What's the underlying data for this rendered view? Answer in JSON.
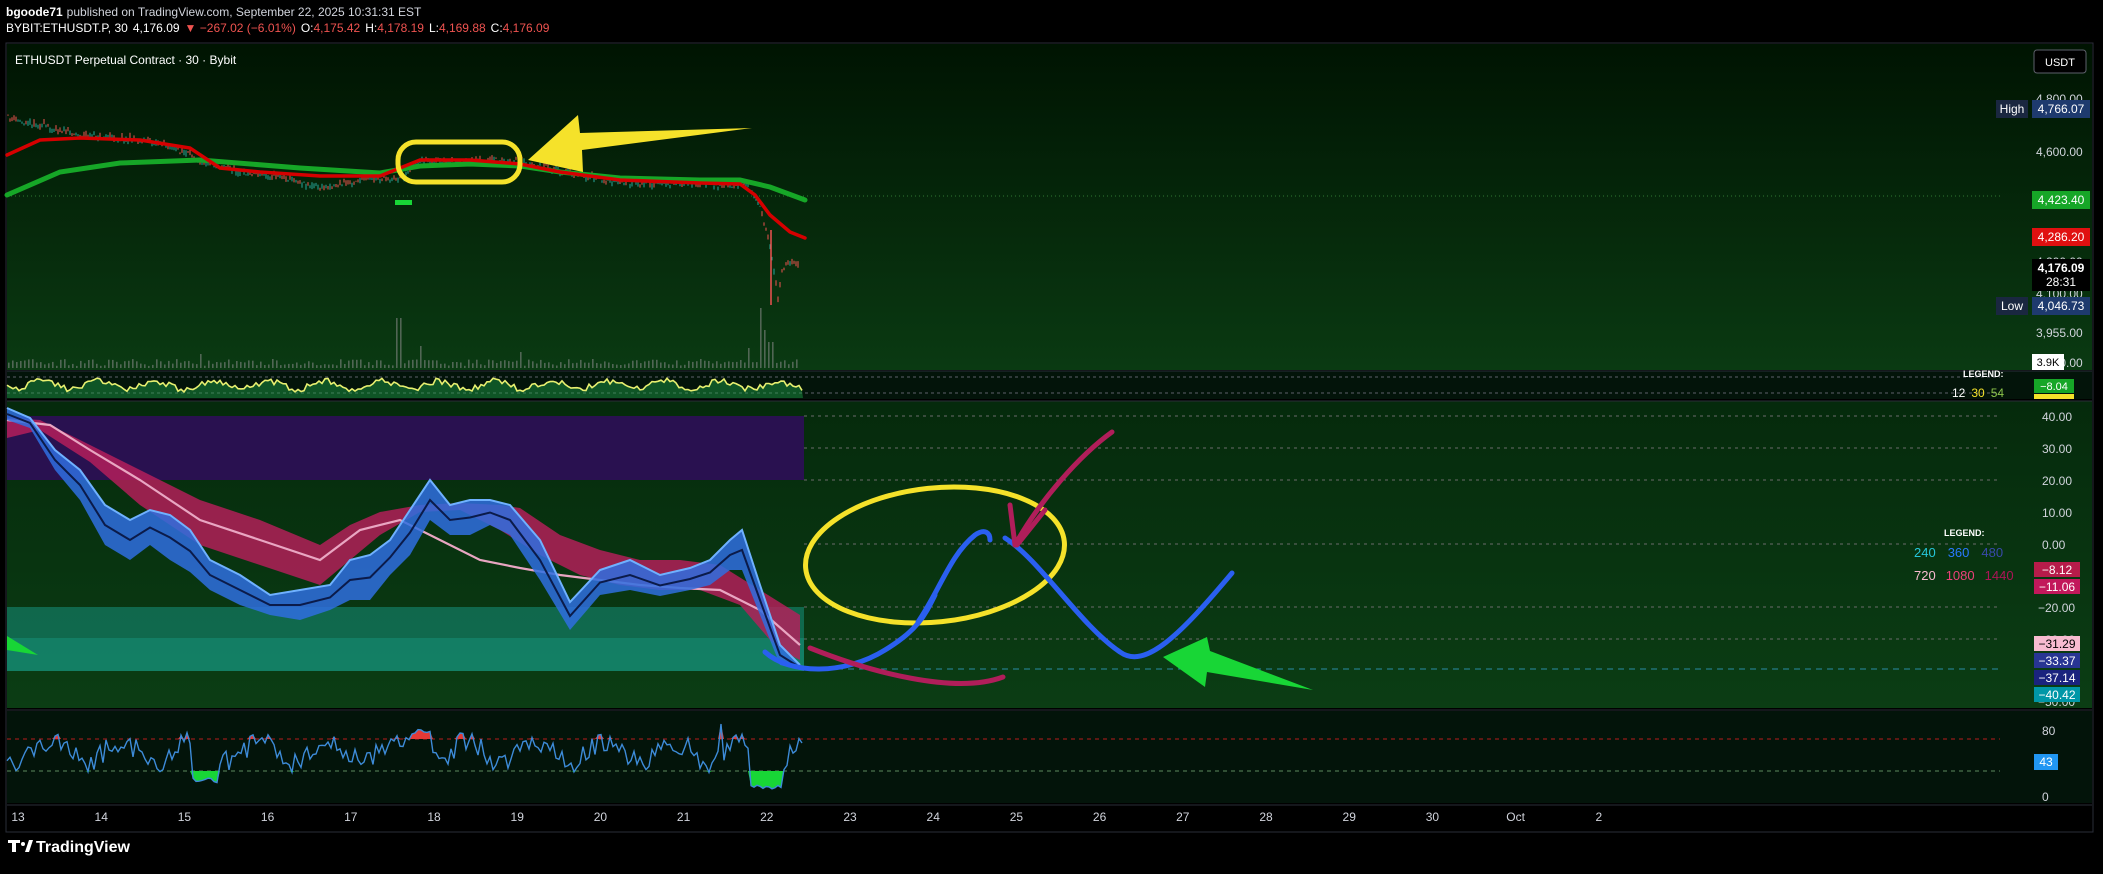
{
  "header": {
    "publisher": "bgoode71",
    "published_text": "published on TradingView.com, September 22, 2025 10:31:31 EST",
    "symbol": "BYBIT:ETHUSDT.P, 30",
    "last": "4,176.09",
    "change": "▼ −267.02 (−6.01%)",
    "o_label": "O:",
    "o": "4,175.42",
    "h_label": "H:",
    "h": "4,178.19",
    "l_label": "L:",
    "l": "4,169.88",
    "c_label": "C:",
    "c": "4,176.09"
  },
  "chart_title": "ETHUSDT Perpetual Contract · 30 · Bybit",
  "currency_button": "USDT",
  "colors": {
    "up": "#26a69a",
    "down": "#ef5350",
    "ma_fast": "#d50000",
    "ma_slow": "#16a627",
    "annotation_yellow": "#f5e22a",
    "annotation_blue": "#2a5ff0",
    "annotation_red": "#b01e5a",
    "annotation_green": "#18d636"
  },
  "price_pane": {
    "axis_labels": [
      "4,800.00",
      "4,600.00",
      "4,200.00",
      "4,100.00",
      "3,955.00",
      "3,800.00"
    ],
    "badges": {
      "high_label": "High",
      "high": "4,766.07",
      "ma_slow": "4,423.40",
      "ma_fast": "4,286.20",
      "last": "4,176.09",
      "countdown": "28:31",
      "low_label": "Low",
      "low": "4,046.73",
      "volume": "3.9K"
    }
  },
  "osc_pane": {
    "legend_title": "LEGEND:",
    "legend_values": [
      "12",
      "30",
      "54"
    ],
    "value_badge": "−8.04"
  },
  "ribbon_pane": {
    "axis_labels": [
      "40.00",
      "30.00",
      "20.00",
      "10.00",
      "0.00",
      "−20.00",
      "−30.00",
      "−50.00"
    ],
    "legend_title": "LEGEND:",
    "legend_row1": [
      "240",
      "360",
      "480"
    ],
    "legend_row2": [
      "720",
      "1080",
      "1440"
    ],
    "badges": [
      "−8.12",
      "−11.06",
      "−31.29",
      "−33.37",
      "−37.14",
      "−40.42"
    ]
  },
  "rsi_pane": {
    "axis_labels": [
      "80",
      "0"
    ],
    "value_badge": "43"
  },
  "time_axis": [
    "13",
    "14",
    "15",
    "16",
    "17",
    "18",
    "19",
    "20",
    "21",
    "22",
    "23",
    "24",
    "25",
    "26",
    "27",
    "28",
    "29",
    "30",
    "Oct",
    "2"
  ],
  "footer": {
    "logo_text": "TradingView"
  }
}
